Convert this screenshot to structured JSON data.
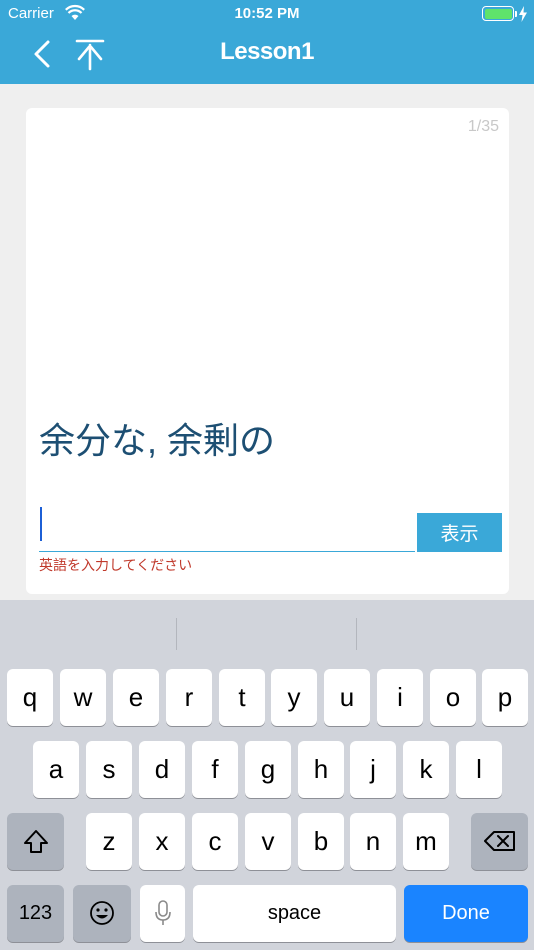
{
  "status": {
    "carrier": "Carrier",
    "time": "10:52 PM",
    "battery_color": "#5fe36b"
  },
  "nav": {
    "title": "Lesson1",
    "accent": "#3aa8d8"
  },
  "card": {
    "counter": "1/35",
    "prompt": "余分な, 余剰の",
    "input_value": "",
    "show_label": "表示",
    "error": "英語を入力してください"
  },
  "keyboard": {
    "row1": [
      "q",
      "w",
      "e",
      "r",
      "t",
      "y",
      "u",
      "i",
      "o",
      "p"
    ],
    "row2": [
      "a",
      "s",
      "d",
      "f",
      "g",
      "h",
      "j",
      "k",
      "l"
    ],
    "row3": [
      "z",
      "x",
      "c",
      "v",
      "b",
      "n",
      "m"
    ],
    "numbers_label": "123",
    "space_label": "space",
    "done_label": "Done"
  }
}
